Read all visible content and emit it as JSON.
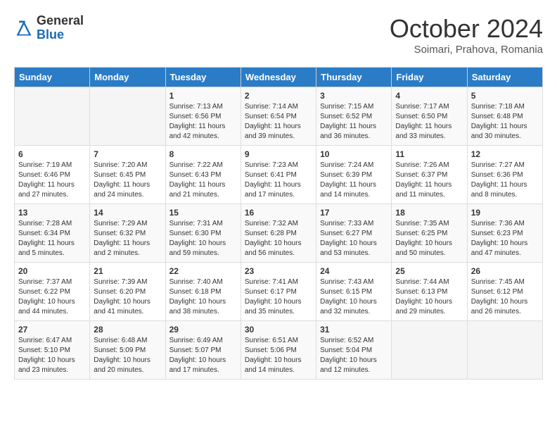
{
  "header": {
    "logo_general": "General",
    "logo_blue": "Blue",
    "month_title": "October 2024",
    "subtitle": "Soimari, Prahova, Romania"
  },
  "weekdays": [
    "Sunday",
    "Monday",
    "Tuesday",
    "Wednesday",
    "Thursday",
    "Friday",
    "Saturday"
  ],
  "weeks": [
    [
      {
        "day": "",
        "info": ""
      },
      {
        "day": "",
        "info": ""
      },
      {
        "day": "1",
        "info": "Sunrise: 7:13 AM\nSunset: 6:56 PM\nDaylight: 11 hours and 42 minutes."
      },
      {
        "day": "2",
        "info": "Sunrise: 7:14 AM\nSunset: 6:54 PM\nDaylight: 11 hours and 39 minutes."
      },
      {
        "day": "3",
        "info": "Sunrise: 7:15 AM\nSunset: 6:52 PM\nDaylight: 11 hours and 36 minutes."
      },
      {
        "day": "4",
        "info": "Sunrise: 7:17 AM\nSunset: 6:50 PM\nDaylight: 11 hours and 33 minutes."
      },
      {
        "day": "5",
        "info": "Sunrise: 7:18 AM\nSunset: 6:48 PM\nDaylight: 11 hours and 30 minutes."
      }
    ],
    [
      {
        "day": "6",
        "info": "Sunrise: 7:19 AM\nSunset: 6:46 PM\nDaylight: 11 hours and 27 minutes."
      },
      {
        "day": "7",
        "info": "Sunrise: 7:20 AM\nSunset: 6:45 PM\nDaylight: 11 hours and 24 minutes."
      },
      {
        "day": "8",
        "info": "Sunrise: 7:22 AM\nSunset: 6:43 PM\nDaylight: 11 hours and 21 minutes."
      },
      {
        "day": "9",
        "info": "Sunrise: 7:23 AM\nSunset: 6:41 PM\nDaylight: 11 hours and 17 minutes."
      },
      {
        "day": "10",
        "info": "Sunrise: 7:24 AM\nSunset: 6:39 PM\nDaylight: 11 hours and 14 minutes."
      },
      {
        "day": "11",
        "info": "Sunrise: 7:26 AM\nSunset: 6:37 PM\nDaylight: 11 hours and 11 minutes."
      },
      {
        "day": "12",
        "info": "Sunrise: 7:27 AM\nSunset: 6:36 PM\nDaylight: 11 hours and 8 minutes."
      }
    ],
    [
      {
        "day": "13",
        "info": "Sunrise: 7:28 AM\nSunset: 6:34 PM\nDaylight: 11 hours and 5 minutes."
      },
      {
        "day": "14",
        "info": "Sunrise: 7:29 AM\nSunset: 6:32 PM\nDaylight: 11 hours and 2 minutes."
      },
      {
        "day": "15",
        "info": "Sunrise: 7:31 AM\nSunset: 6:30 PM\nDaylight: 10 hours and 59 minutes."
      },
      {
        "day": "16",
        "info": "Sunrise: 7:32 AM\nSunset: 6:28 PM\nDaylight: 10 hours and 56 minutes."
      },
      {
        "day": "17",
        "info": "Sunrise: 7:33 AM\nSunset: 6:27 PM\nDaylight: 10 hours and 53 minutes."
      },
      {
        "day": "18",
        "info": "Sunrise: 7:35 AM\nSunset: 6:25 PM\nDaylight: 10 hours and 50 minutes."
      },
      {
        "day": "19",
        "info": "Sunrise: 7:36 AM\nSunset: 6:23 PM\nDaylight: 10 hours and 47 minutes."
      }
    ],
    [
      {
        "day": "20",
        "info": "Sunrise: 7:37 AM\nSunset: 6:22 PM\nDaylight: 10 hours and 44 minutes."
      },
      {
        "day": "21",
        "info": "Sunrise: 7:39 AM\nSunset: 6:20 PM\nDaylight: 10 hours and 41 minutes."
      },
      {
        "day": "22",
        "info": "Sunrise: 7:40 AM\nSunset: 6:18 PM\nDaylight: 10 hours and 38 minutes."
      },
      {
        "day": "23",
        "info": "Sunrise: 7:41 AM\nSunset: 6:17 PM\nDaylight: 10 hours and 35 minutes."
      },
      {
        "day": "24",
        "info": "Sunrise: 7:43 AM\nSunset: 6:15 PM\nDaylight: 10 hours and 32 minutes."
      },
      {
        "day": "25",
        "info": "Sunrise: 7:44 AM\nSunset: 6:13 PM\nDaylight: 10 hours and 29 minutes."
      },
      {
        "day": "26",
        "info": "Sunrise: 7:45 AM\nSunset: 6:12 PM\nDaylight: 10 hours and 26 minutes."
      }
    ],
    [
      {
        "day": "27",
        "info": "Sunrise: 6:47 AM\nSunset: 5:10 PM\nDaylight: 10 hours and 23 minutes."
      },
      {
        "day": "28",
        "info": "Sunrise: 6:48 AM\nSunset: 5:09 PM\nDaylight: 10 hours and 20 minutes."
      },
      {
        "day": "29",
        "info": "Sunrise: 6:49 AM\nSunset: 5:07 PM\nDaylight: 10 hours and 17 minutes."
      },
      {
        "day": "30",
        "info": "Sunrise: 6:51 AM\nSunset: 5:06 PM\nDaylight: 10 hours and 14 minutes."
      },
      {
        "day": "31",
        "info": "Sunrise: 6:52 AM\nSunset: 5:04 PM\nDaylight: 10 hours and 12 minutes."
      },
      {
        "day": "",
        "info": ""
      },
      {
        "day": "",
        "info": ""
      }
    ]
  ]
}
